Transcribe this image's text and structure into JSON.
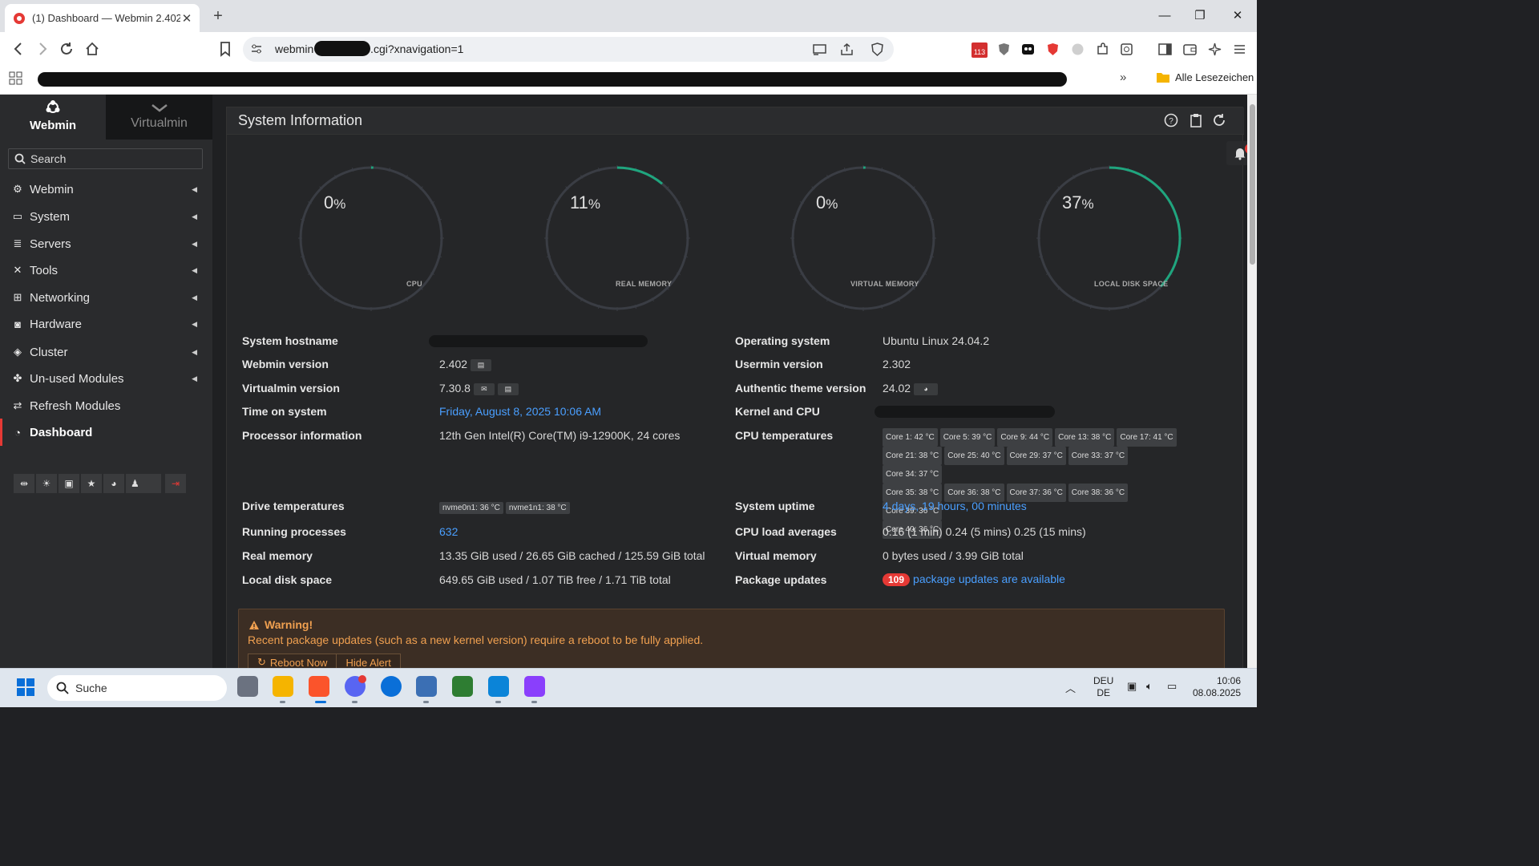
{
  "browser": {
    "tab_title": "(1) Dashboard — Webmin 2.402",
    "new_tab": "+",
    "url": "webmin                 net/sysinfo.cgi?xnavigation=1",
    "ext_badge": "113",
    "bookmarks_more": "»",
    "all_bookmarks": "Alle Lesezeichen"
  },
  "sidebar": {
    "brand_webmin": "Webmin",
    "brand_virtualmin": "Virtualmin",
    "search_placeholder": "Search",
    "items": [
      {
        "label": "Webmin",
        "icon": "gear-icon"
      },
      {
        "label": "System",
        "icon": "laptop-icon"
      },
      {
        "label": "Servers",
        "icon": "server-icon"
      },
      {
        "label": "Tools",
        "icon": "tools-icon"
      },
      {
        "label": "Networking",
        "icon": "network-icon"
      },
      {
        "label": "Hardware",
        "icon": "hdd-icon"
      },
      {
        "label": "Cluster",
        "icon": "layers-icon"
      },
      {
        "label": "Un-used Modules",
        "icon": "puzzle-icon"
      },
      {
        "label": "Refresh Modules",
        "icon": "refresh-icon"
      },
      {
        "label": "Dashboard",
        "icon": "dashboard-icon"
      }
    ]
  },
  "panel": {
    "title": "System Information"
  },
  "gauges": [
    {
      "value": "0",
      "unit": "%",
      "label": "CPU",
      "percent": 0
    },
    {
      "value": "11",
      "unit": "%",
      "label": "REAL MEMORY",
      "percent": 11
    },
    {
      "value": "0",
      "unit": "%",
      "label": "VIRTUAL MEMORY",
      "percent": 0
    },
    {
      "value": "37",
      "unit": "%",
      "label": "LOCAL DISK SPACE",
      "percent": 37
    }
  ],
  "info_left": {
    "hostname_label": "System hostname",
    "webmin_version_label": "Webmin version",
    "webmin_version": "2.402",
    "virtualmin_version_label": "Virtualmin version",
    "virtualmin_version": "7.30.8",
    "time_label": "Time on system",
    "time": "Friday, August 8, 2025 10:06 AM",
    "processor_label": "Processor information",
    "processor": "12th Gen Intel(R) Core(TM) i9-12900K, 24 cores",
    "drive_temps_label": "Drive temperatures",
    "drive_temps": [
      "nvme0n1: 36 °C",
      "nvme1n1: 38 °C"
    ],
    "processes_label": "Running processes",
    "processes": "632",
    "real_memory_label": "Real memory",
    "real_memory": "13.35 GiB used / 26.65 GiB cached / 125.59 GiB total",
    "disk_label": "Local disk space",
    "disk": "649.65 GiB used / 1.07 TiB free / 1.71 TiB total"
  },
  "info_right": {
    "os_label": "Operating system",
    "os": "Ubuntu Linux 24.04.2",
    "usermin_label": "Usermin version",
    "usermin": "2.302",
    "theme_label": "Authentic theme version",
    "theme": "24.02",
    "kernel_label": "Kernel and CPU",
    "cpu_temps_label": "CPU temperatures",
    "cpu_temps": [
      "Core 1: 42 °C",
      "Core 5: 39 °C",
      "Core 9: 44 °C",
      "Core 13: 38 °C",
      "Core 17: 41 °C",
      "Core 21: 38 °C",
      "Core 25: 40 °C",
      "Core 29: 37 °C",
      "Core 33: 37 °C",
      "Core 34: 37 °C",
      "Core 35: 38 °C",
      "Core 36: 38 °C",
      "Core 37: 36 °C",
      "Core 38: 36 °C",
      "Core 39: 36 °C",
      "Core 40: 36 °C"
    ],
    "uptime_label": "System uptime",
    "uptime": "4 days, 19 hours, 00 minutes",
    "load_label": "CPU load averages",
    "load": "0.16 (1 min) 0.24 (5 mins) 0.25 (15 mins)",
    "virtual_memory_label": "Virtual memory",
    "virtual_memory": "0 bytes used / 3.99 GiB total",
    "packages_label": "Package updates",
    "packages_count": "109",
    "packages_text": "package updates are available"
  },
  "alert": {
    "title": "Warning!",
    "message": "Recent package updates (such as a new kernel version) require a reboot to be fully applied.",
    "reboot_button": "Reboot Now",
    "hide_button": "Hide Alert"
  },
  "notifications": {
    "count": "1"
  },
  "taskbar": {
    "search_placeholder": "Suche",
    "lang_top": "DEU",
    "lang_bottom": "DE",
    "time": "10:06",
    "date": "08.08.2025"
  },
  "colors": {
    "gauge_track": "#3a3d44",
    "gauge_fill": "#1fa57e",
    "accent_link": "#4a9fff",
    "warning": "#f0a050",
    "danger": "#e53935"
  }
}
